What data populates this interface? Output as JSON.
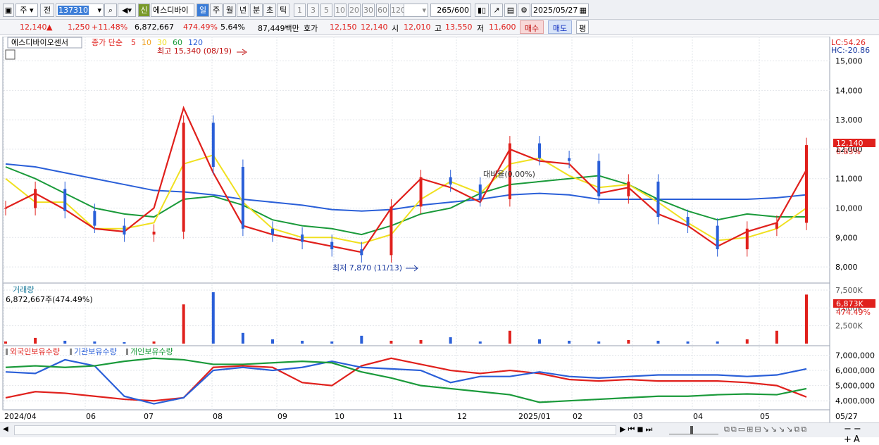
{
  "toolbar": {
    "market": "주",
    "prev": "전",
    "code": "137310",
    "credit_badge": "신",
    "stock_name": "에스디바이",
    "periods": [
      "일",
      "주",
      "월",
      "년",
      "분",
      "초",
      "틱"
    ],
    "minute_opts": [
      "1",
      "3",
      "5",
      "10",
      "20",
      "30",
      "60",
      "120"
    ],
    "count": "265",
    "total": "/600",
    "date": "2025/05/27"
  },
  "quote": {
    "price": "12,140",
    "change_arrow": "▲",
    "change": "1,250",
    "change_pct": "+11.48%",
    "volume": "6,872,667",
    "volume_ratio": "474.49%",
    "turnover": "5.64%",
    "amount": "87,449백만",
    "ask_label": "호가",
    "ask": "12,150",
    "bid": "12,140",
    "open_label": "시",
    "open": "12,010",
    "high_label": "고",
    "high": "13,550",
    "low_label": "저",
    "low": "11,600",
    "buy_btn": "매수",
    "sell_btn": "매도",
    "eval_btn": "평"
  },
  "price_panel": {
    "stock_tab": "에스디바이오센서",
    "ma_label": "종가 단순",
    "ma_periods": [
      "5",
      "10",
      "30",
      "60",
      "120"
    ],
    "ma_colors": [
      "#e0201c",
      "#f0a020",
      "#f0e020",
      "#1a9a3a",
      "#2a5fd8"
    ],
    "high_note": "최고 15,340 (08/19)",
    "low_note": "최저 7,870 (11/13)",
    "mid_note": "대비율(0.00%)",
    "lc": "LC:54.26",
    "hc": "HC:-20.86",
    "last_price_tag": "12,140",
    "last_pct_tag": "0.83%"
  },
  "volume_panel": {
    "title": "거래량",
    "value": "6,872,667주(474.49%)",
    "last_tag": "6,873K",
    "last_pct": "474.49%"
  },
  "holdings_panel": {
    "labels": [
      "외국인보유수량",
      "기관보유수량",
      "개인보유수량"
    ],
    "colors": [
      "#e0201c",
      "#2a5fd8",
      "#1a9a3a"
    ]
  },
  "x_axis_labels": [
    "2024/04",
    "06",
    "07",
    "08",
    "09",
    "10",
    "11",
    "12",
    "2025/01",
    "02",
    "03",
    "04",
    "05",
    "05/27"
  ],
  "chart_data": [
    {
      "type": "candlestick",
      "title": "에스디바이오센서",
      "ylim": [
        7500,
        15300
      ],
      "yticks": [
        "15,000",
        "14,000",
        "13,000",
        "12,000",
        "11,000",
        "10,000",
        "9,000",
        "8,000"
      ],
      "x": [
        "2024/04",
        "06",
        "07",
        "08",
        "09",
        "10",
        "11",
        "12",
        "2025/01",
        "02",
        "03",
        "04",
        "05",
        "05/27"
      ],
      "close": [
        10000,
        10650,
        9900,
        9400,
        9100,
        9200,
        12900,
        11400,
        9300,
        9100,
        8850,
        8600,
        8400,
        10050,
        11050,
        10800,
        10300,
        12200,
        11700,
        11600,
        10400,
        10900,
        9700,
        9400,
        8600,
        9300,
        9500,
        12140
      ],
      "ma_series": [
        {
          "name": "5",
          "values": [
            10000,
            10500,
            9950,
            9300,
            9200,
            10000,
            13400,
            11200,
            9400,
            9100,
            8900,
            8700,
            8500,
            10000,
            11000,
            10700,
            10200,
            12000,
            11600,
            11500,
            10500,
            10700,
            9800,
            9400,
            8700,
            9200,
            9500,
            11300
          ]
        },
        {
          "name": "30",
          "values": [
            11000,
            10200,
            10200,
            9300,
            9300,
            9500,
            11500,
            11800,
            10200,
            9300,
            9000,
            9000,
            8800,
            9100,
            10300,
            10900,
            10500,
            11500,
            11700,
            11100,
            10700,
            10800,
            10200,
            9500,
            8900,
            9000,
            9300,
            10000
          ]
        },
        {
          "name": "60",
          "values": [
            11400,
            11000,
            10500,
            10000,
            9800,
            9700,
            10300,
            10400,
            10100,
            9600,
            9400,
            9300,
            9100,
            9400,
            9800,
            10000,
            10500,
            10800,
            10900,
            11000,
            11100,
            10800,
            10300,
            9900,
            9600,
            9800,
            9700,
            9700
          ]
        },
        {
          "name": "120",
          "values": [
            11500,
            11400,
            11200,
            11000,
            10800,
            10600,
            10550,
            10450,
            10300,
            10200,
            10100,
            9950,
            9900,
            9950,
            10100,
            10200,
            10300,
            10450,
            10500,
            10450,
            10300,
            10300,
            10300,
            10300,
            10300,
            10300,
            10350,
            10450
          ]
        }
      ]
    },
    {
      "type": "bar",
      "title": "거래량",
      "yticks": [
        "7,500K",
        "5,000K",
        "2,500K"
      ],
      "ylim": [
        0,
        7500
      ],
      "values_k": [
        300,
        800,
        400,
        300,
        200,
        300,
        5500,
        7200,
        1500,
        600,
        400,
        300,
        1100,
        400,
        500,
        900,
        300,
        1800,
        600,
        400,
        300,
        500,
        400,
        300,
        300,
        600,
        1800,
        6873
      ]
    },
    {
      "type": "line",
      "title": "보유수량",
      "yticks": [
        "7,000,000",
        "6,000,000",
        "5,000,000",
        "4,000,000"
      ],
      "ylim": [
        3500000,
        7300000
      ],
      "series": [
        {
          "name": "외국인보유수량",
          "values": [
            4200000,
            4600000,
            4500000,
            4300000,
            4100000,
            4000000,
            4200000,
            6200000,
            6300000,
            6200000,
            5200000,
            5000000,
            6300000,
            6800000,
            6400000,
            6000000,
            5800000,
            6000000,
            5800000,
            5400000,
            5300000,
            5400000,
            5300000,
            5300000,
            5300000,
            5200000,
            5000000,
            4250000
          ]
        },
        {
          "name": "기관보유수량",
          "values": [
            5900000,
            5800000,
            6700000,
            6300000,
            4300000,
            3800000,
            4200000,
            6000000,
            6200000,
            6000000,
            6200000,
            6600000,
            6200000,
            6100000,
            6000000,
            5200000,
            5600000,
            5600000,
            5900000,
            5600000,
            5500000,
            5600000,
            5700000,
            5700000,
            5700000,
            5600000,
            5700000,
            6100000
          ]
        },
        {
          "name": "개인보유수량",
          "values": [
            6200000,
            6300000,
            6200000,
            6300000,
            6600000,
            6800000,
            6700000,
            6400000,
            6400000,
            6500000,
            6600000,
            6500000,
            5900000,
            5500000,
            5000000,
            4800000,
            4600000,
            4400000,
            3900000,
            4000000,
            4100000,
            4200000,
            4300000,
            4300000,
            4400000,
            4450000,
            4400000,
            4800000
          ]
        }
      ]
    }
  ]
}
